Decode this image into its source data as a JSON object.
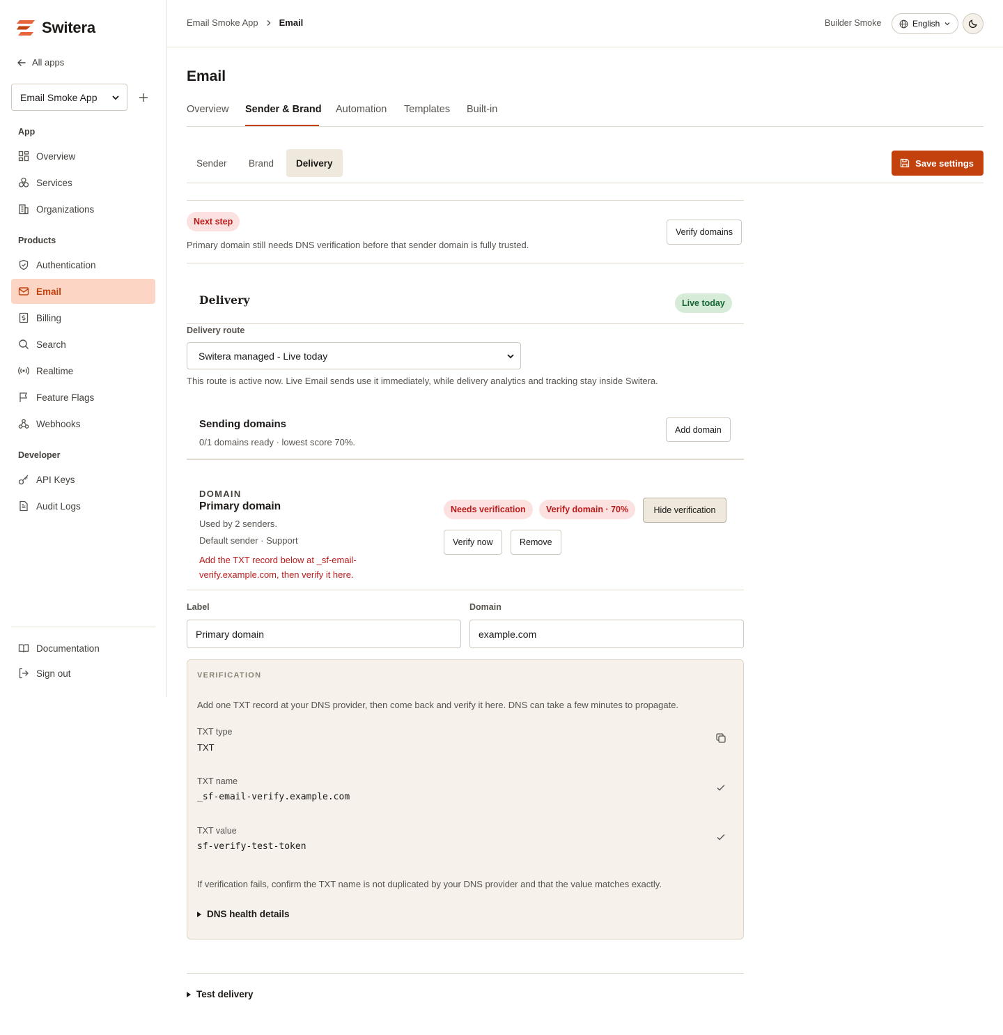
{
  "brand": {
    "name": "Switera",
    "accent": "#c2410c"
  },
  "sidebar": {
    "all_apps": "All apps",
    "app_select": "Email Smoke App",
    "sections": {
      "app": "App",
      "products": "Products",
      "developer": "Developer"
    },
    "items": {
      "overview": "Overview",
      "services": "Services",
      "organizations": "Organizations",
      "authentication": "Authentication",
      "email": "Email",
      "billing": "Billing",
      "search": "Search",
      "realtime": "Realtime",
      "feature_flags": "Feature Flags",
      "webhooks": "Webhooks",
      "api_keys": "API Keys",
      "audit_logs": "Audit Logs",
      "documentation": "Documentation",
      "sign_out": "Sign out"
    }
  },
  "topbar": {
    "breadcrumb": [
      "Email Smoke App",
      "Email"
    ],
    "user": "Builder Smoke",
    "language": "English"
  },
  "page": {
    "title": "Email",
    "tabs": [
      "Overview",
      "Sender & Brand",
      "Automation",
      "Templates",
      "Built-in"
    ],
    "subtabs": [
      "Sender",
      "Brand",
      "Delivery"
    ],
    "save_label": "Save settings"
  },
  "next_step": {
    "badge": "Next step",
    "text": "Primary domain still needs DNS verification before that sender domain is fully trusted.",
    "button": "Verify domains"
  },
  "delivery": {
    "title": "Delivery",
    "status": "Live today",
    "route_label": "Delivery route",
    "route_value": "Switera managed - Live today",
    "route_help": "This route is active now. Live Email sends use it immediately, while delivery analytics and tracking stay inside Switera."
  },
  "sending_domains": {
    "title": "Sending domains",
    "summary": "0/1 domains ready · lowest score 70%.",
    "add_button": "Add domain"
  },
  "domain": {
    "eyebrow": "DOMAIN",
    "name": "Primary domain",
    "used_by": "Used by 2 senders.",
    "default_sender": "Default sender · Support",
    "instruction": "Add the TXT record below at _sf-email-verify.example.com, then verify it here.",
    "badge_needs": "Needs verification",
    "badge_score": "Verify domain · 70%",
    "hide_button": "Hide verification",
    "verify_button": "Verify now",
    "remove_button": "Remove",
    "label_field": "Label",
    "label_value": "Primary domain",
    "domain_field": "Domain",
    "domain_value": "example.com"
  },
  "verification": {
    "eyebrow": "VERIFICATION",
    "intro": "Add one TXT record at your DNS provider, then come back and verify it here. DNS can take a few minutes to propagate.",
    "records": [
      {
        "label": "TXT type",
        "value": "TXT",
        "icon": "copy-icon"
      },
      {
        "label": "TXT name",
        "value": "_sf-email-verify.example.com",
        "icon": "check-icon"
      },
      {
        "label": "TXT value",
        "value": "sf-verify-test-token",
        "icon": "check-icon"
      }
    ],
    "help": "If verification fails, confirm the TXT name is not duplicated by your DNS provider and that the value matches exactly.",
    "dns_details": "DNS health details"
  },
  "test_delivery": "Test delivery"
}
